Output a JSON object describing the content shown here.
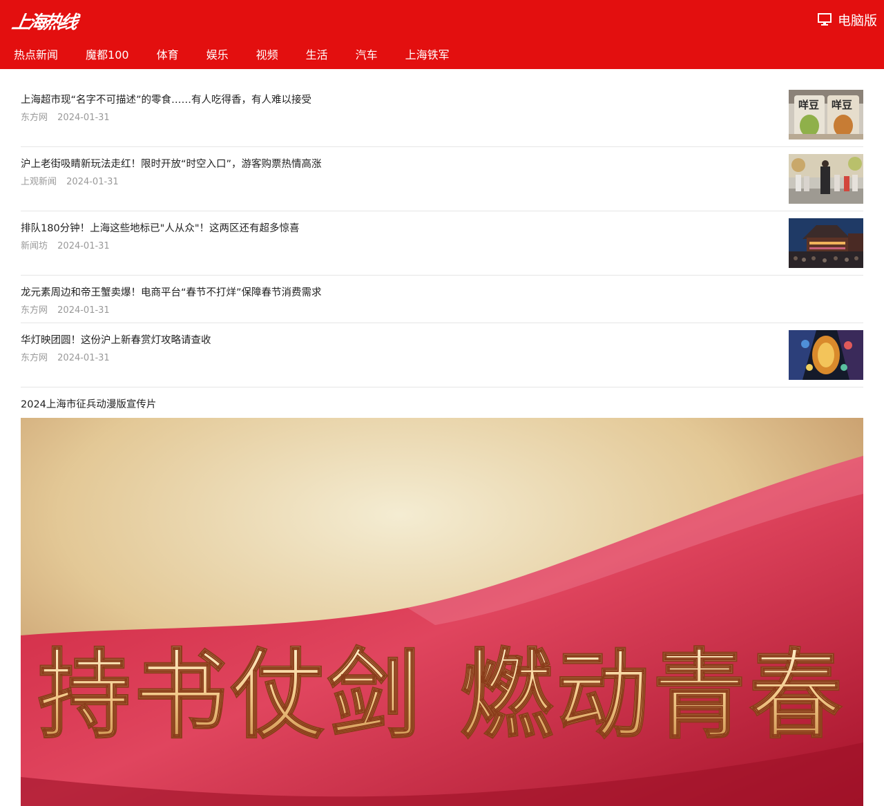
{
  "header": {
    "logo_text": "上海热线",
    "pc_label": "电脑版",
    "bg_color": "#e30f0f"
  },
  "nav": [
    {
      "label": "热点新闻"
    },
    {
      "label": "魔都100"
    },
    {
      "label": "体育"
    },
    {
      "label": "娱乐"
    },
    {
      "label": "视频"
    },
    {
      "label": "生活"
    },
    {
      "label": "汽车"
    },
    {
      "label": "上海铁军"
    }
  ],
  "news": [
    {
      "title": "上海超市现“名字不可描述”的零食……有人吃得香，有人难以接受",
      "source": "东方网",
      "date": "2024-01-31",
      "image": "snack-packages"
    },
    {
      "title": "沪上老街吸睛新玩法走红！限时开放“时空入口”，游客购票热情高涨",
      "source": "上观新闻",
      "date": "2024-01-31",
      "image": "costumed-performer-street"
    },
    {
      "title": "排队180分钟！上海这些地标已\"人从众\"！这两区还有超多惊喜",
      "source": "新闻坊",
      "date": "2024-01-31",
      "image": "night-crowd-pavilion"
    },
    {
      "title": "龙元素周边和帝王蟹卖爆！电商平台“春节不打烊”保障春节消费需求",
      "source": "东方网",
      "date": "2024-01-31",
      "image": null
    },
    {
      "title": "华灯映团圆！这份沪上新春赏灯攻略请查收",
      "source": "东方网",
      "date": "2024-01-31",
      "image": "lantern-festival"
    }
  ],
  "video": {
    "title": "2024上海市征兵动漫版宣传片",
    "poster_text": "持书仗剑 燃动青春"
  }
}
